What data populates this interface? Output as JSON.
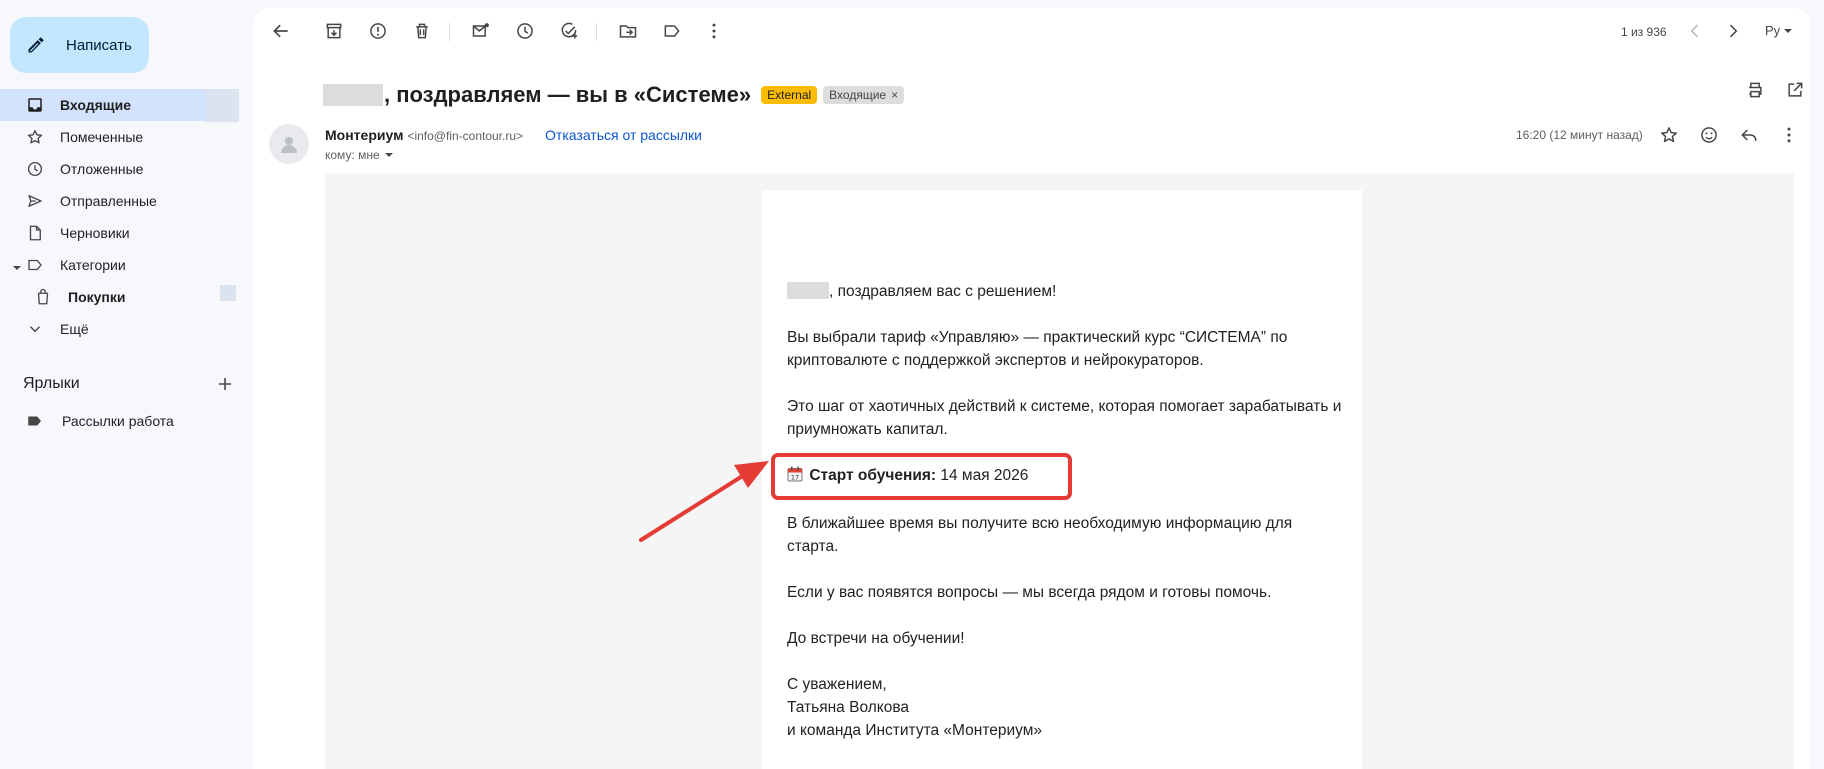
{
  "sidebar": {
    "compose_label": "Написать",
    "items": [
      {
        "label": "Входящие",
        "icon": "inbox-icon"
      },
      {
        "label": "Помеченные",
        "icon": "star-icon"
      },
      {
        "label": "Отложенные",
        "icon": "clock-icon"
      },
      {
        "label": "Отправленные",
        "icon": "send-icon"
      },
      {
        "label": "Черновики",
        "icon": "draft-icon"
      },
      {
        "label": "Категории",
        "icon": "label-outline-icon"
      },
      {
        "label": "Покупки",
        "icon": "shopping-bag-icon"
      },
      {
        "label": "Ещё",
        "icon": "chevron-down-icon"
      }
    ],
    "labels_heading": "Ярлыки",
    "labels": [
      {
        "label": "Рассылки работа",
        "icon": "label-filled-icon"
      }
    ]
  },
  "toolbar": {
    "pager": "1 из 936",
    "language": "Ру"
  },
  "message": {
    "subject": ", поздравляем — вы в «Системе»",
    "chips": {
      "external": "External",
      "inbox": "Входящие",
      "remove_symbol": "×"
    },
    "sender_name": "Монтериум",
    "sender_email": "<info@fin-contour.ru>",
    "unsubscribe": "Отказаться от рассылки",
    "to": "кому: мне",
    "time": "16:20 (12 минут назад)"
  },
  "body": {
    "greeting": ", поздравляем вас с решением!",
    "p1": "Вы выбрали тариф «Управляю» — практический курс “СИСТЕМА” по криптовалюте с поддержкой экспертов и нейрокураторов.",
    "p2": "Это шаг от хаотичных действий к системе, которая помогает зарабатывать и приумножать капитал.",
    "start_label": "Старт обучения:",
    "start_date": "14 мая 2026",
    "p3": "В ближайшее время вы получите всю необходимую информацию для старта.",
    "p4": "Если у вас появятся вопросы — мы всегда рядом и готовы помочь.",
    "p5": "До встречи на обучении!",
    "sign_1": "С уважением,",
    "sign_2": "Татьяна Волкова",
    "sign_3": "и команда  Института «Монтериум»"
  },
  "colors": {
    "accent_blue": "#0b57d0",
    "compose_bg": "#c2e7ff",
    "active_nav": "#d3e3fd",
    "external_chip": "#fbbc04",
    "annotation_red": "#e43b35"
  }
}
